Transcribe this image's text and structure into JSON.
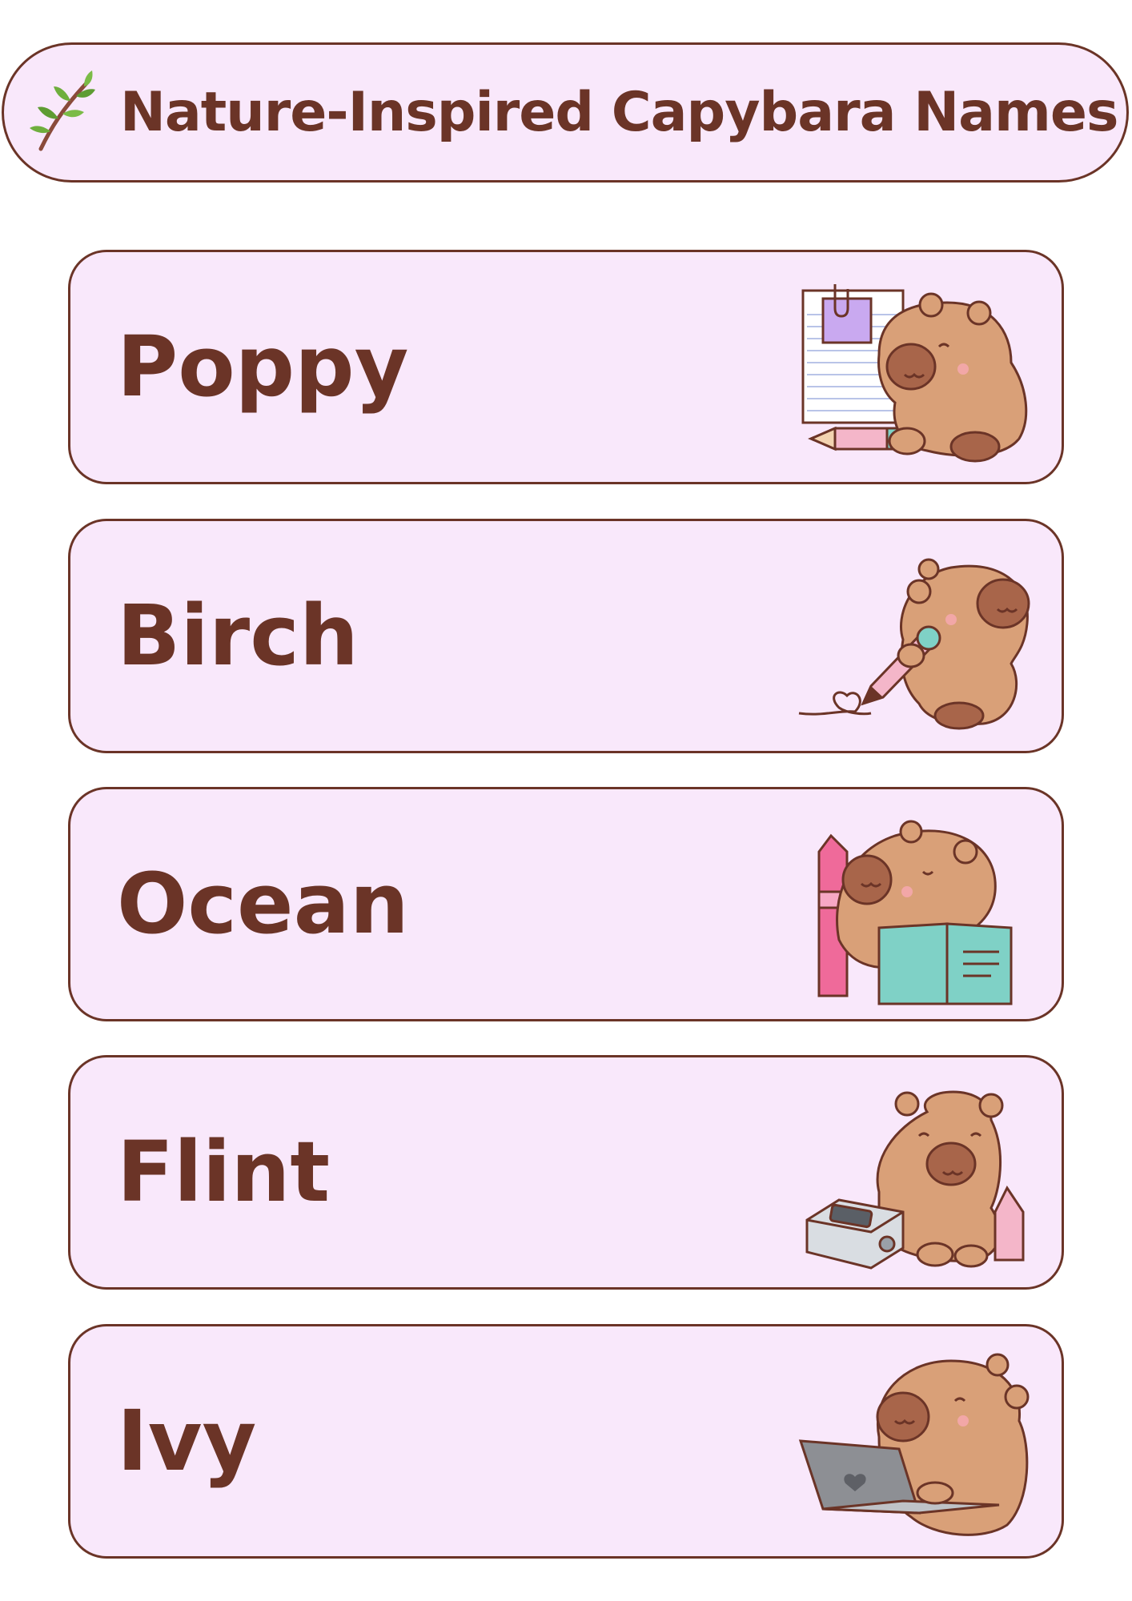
{
  "header": {
    "title": "Nature-Inspired Capybara Names",
    "icon": "leafy-branch-icon"
  },
  "cards": [
    {
      "name": "Poppy",
      "illustration": "capybara-with-notepad-and-pencil"
    },
    {
      "name": "Birch",
      "illustration": "capybara-drawing-heart-with-pencil"
    },
    {
      "name": "Ocean",
      "illustration": "capybara-reading-book-with-crayon"
    },
    {
      "name": "Flint",
      "illustration": "capybara-with-pencil-sharpener"
    },
    {
      "name": "Ivy",
      "illustration": "capybara-with-laptop"
    }
  ],
  "colors": {
    "card_fill": "#f9e8fb",
    "border_text": "#6b3427",
    "capybara": "#d9a078",
    "capybara_dark": "#a8654a"
  }
}
